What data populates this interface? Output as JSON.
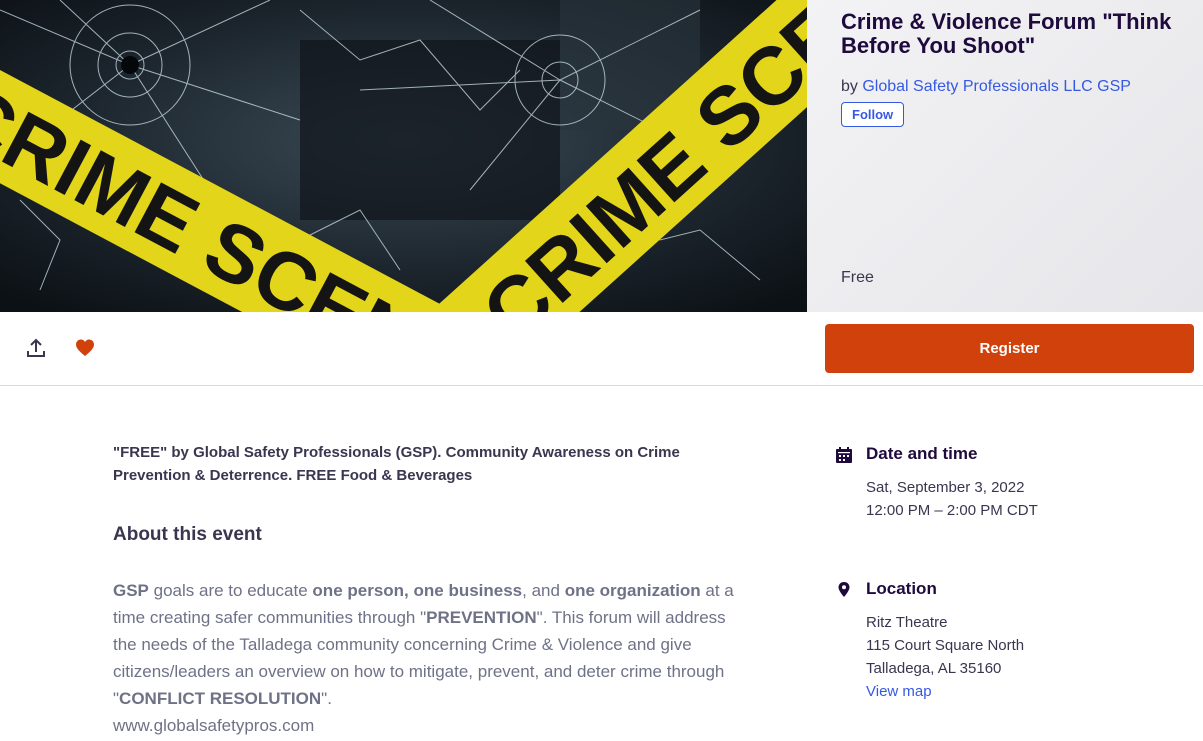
{
  "event": {
    "title": "Crime & Violence Forum \"Think Before You Shoot\"",
    "organizer_prefix": "by",
    "organizer_name": "Global Safety Professionals LLC GSP",
    "follow_label": "Follow",
    "price": "Free",
    "hero_image_text": "CRIME SCENE"
  },
  "actions": {
    "share_icon": "share-icon",
    "like_icon": "heart-icon",
    "register_label": "Register"
  },
  "summary": "\"FREE\" by Global Safety Professionals (GSP). Community Awareness on Crime Prevention & Deterrence. FREE Food & Beverages",
  "about": {
    "heading": "About this event",
    "p1_gsp": "GSP",
    "p1_t1": " goals are to educate ",
    "p1_b1": "one person, one business",
    "p1_t2": ", and ",
    "p1_b2": "one organization",
    "p1_t3": " at a time creating safer communities through \"",
    "p1_b3": "PREVENTION",
    "p1_t4": "\". This forum will address the needs of the Talladega community concerning Crime & Violence and give citizens/leaders an overview on how to mitigate, prevent, and deter crime through \"",
    "p1_b4": "CONFLICT RESOLUTION",
    "p1_t5": "\".",
    "website": "www.globalsafetypros.com"
  },
  "date_time": {
    "heading": "Date and time",
    "date": "Sat, September 3, 2022",
    "time": "12:00 PM – 2:00 PM CDT"
  },
  "location": {
    "heading": "Location",
    "venue": "Ritz Theatre",
    "street": "115 Court Square North",
    "city": "Talladega, AL 35160",
    "map_link": "View map"
  },
  "colors": {
    "accent_orange": "#d1410c",
    "link_blue": "#3659e3",
    "title_dark": "#1e0a3c",
    "tape_yellow": "#e2d51a"
  }
}
